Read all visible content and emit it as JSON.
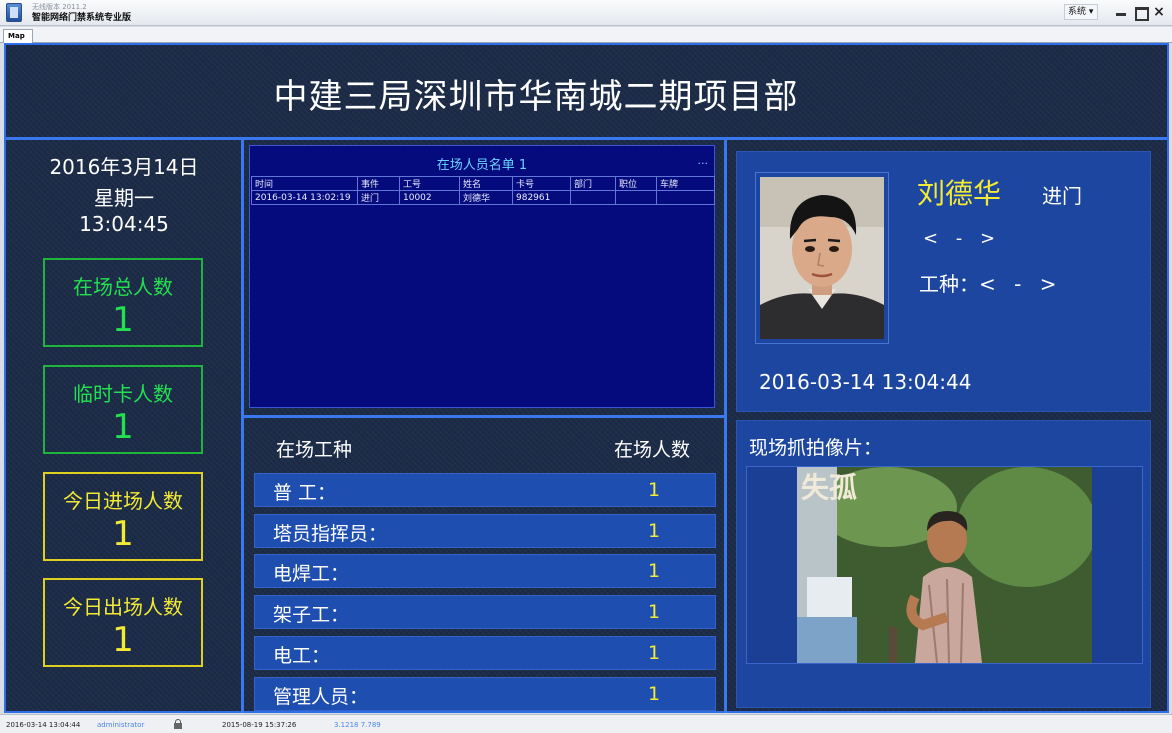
{
  "window": {
    "subtitle": "无线版本 2011.2",
    "title": "智能网络门禁系统专业版",
    "system_menu": "系统 ▾",
    "close_glyph": "×"
  },
  "tab": {
    "label": "Map"
  },
  "board": {
    "title": "中建三局深圳市华南城二期项目部",
    "date": "2016年3月14日",
    "weekday": "星期一",
    "time": "13:04:45",
    "stats": [
      {
        "label": "在场总人数",
        "value": "1"
      },
      {
        "label": "临时卡人数",
        "value": "1"
      },
      {
        "label": "今日进场人数",
        "value": "1"
      },
      {
        "label": "今日出场人数",
        "value": "1"
      }
    ]
  },
  "roster": {
    "title": "在场人员名单 1",
    "more": "...",
    "columns": [
      "时间",
      "事件",
      "工号",
      "姓名",
      "卡号",
      "部门",
      "职位",
      "车牌"
    ],
    "rows": [
      [
        "2016-03-14 13:02:19",
        "进门",
        "10002",
        "刘德华",
        "982961",
        "",
        "",
        ""
      ]
    ]
  },
  "trades": {
    "header_trade": "在场工种",
    "header_count": "在场人数",
    "items": [
      {
        "name": "普 工：",
        "count": "1"
      },
      {
        "name": "塔员指挥员：",
        "count": "1"
      },
      {
        "name": "电焊工：",
        "count": "1"
      },
      {
        "name": "架子工：",
        "count": "1"
      },
      {
        "name": "电工：",
        "count": "1"
      },
      {
        "name": "管理人员：",
        "count": "1"
      }
    ]
  },
  "person": {
    "name": "刘德华",
    "direction": "进门",
    "dept": "< - >",
    "trade_label": "工种：",
    "trade_value": "< - >",
    "swipe_time": "2016-03-14 13:04:44"
  },
  "snapshot": {
    "label": "现场抓拍像片：",
    "poster_title": "失孤"
  },
  "status": {
    "date": "2016-03-14 13:04:44",
    "user": "administrator",
    "build_time": "2015-08-19 15:37:26",
    "version": "3.1218 7.789"
  }
}
